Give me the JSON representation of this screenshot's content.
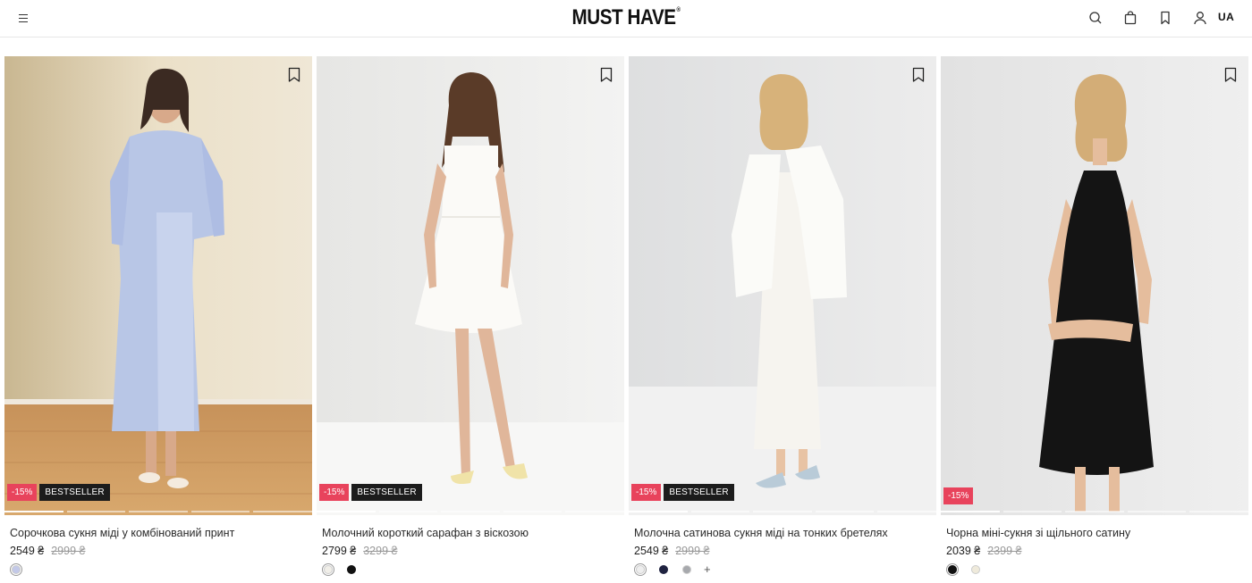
{
  "header": {
    "logo": "MUST HAVE",
    "logo_mark": "®",
    "lang": "UA",
    "icons": [
      "menu-icon",
      "search-icon",
      "cart-icon",
      "bookmark-icon",
      "user-icon"
    ]
  },
  "products": [
    {
      "name": "Сорочкова сукня міді у комбінований принт",
      "price": "2549 ₴",
      "old_price": "2999 ₴",
      "discount": "-15%",
      "badge": "BESTSELLER",
      "colors": [
        "#c3c9e8"
      ],
      "more": ""
    },
    {
      "name": "Молочний короткий сарафан з віскозою",
      "price": "2799 ₴",
      "old_price": "3299 ₴",
      "discount": "-15%",
      "badge": "BESTSELLER",
      "colors": [
        "#f1efe9",
        "#111111"
      ],
      "more": ""
    },
    {
      "name": "Молочна сатинова сукня міді на тонких бретелях",
      "price": "2549 ₴",
      "old_price": "2999 ₴",
      "discount": "-15%",
      "badge": "BESTSELLER",
      "colors": [
        "#eeeeee",
        "#1f2340",
        "#a7a9ad"
      ],
      "more": "+"
    },
    {
      "name": "Чорна міні-сукня зі щільного сатину",
      "price": "2039 ₴",
      "old_price": "2399 ₴",
      "discount": "-15%",
      "badge": "",
      "colors": [
        "#111111",
        "#efeadb"
      ],
      "more": ""
    }
  ]
}
